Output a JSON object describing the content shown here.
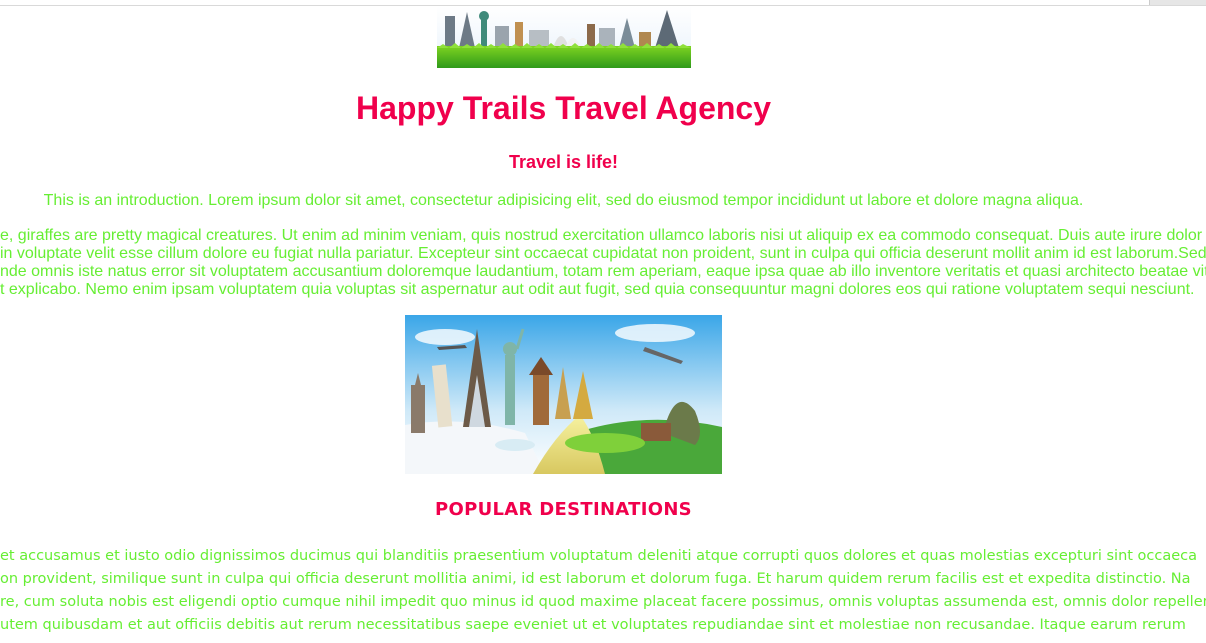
{
  "banner": {
    "icon": "world-landmarks-banner-image"
  },
  "header": {
    "title": "Happy Trails Travel Agency",
    "subtitle": "Travel is life!"
  },
  "intro": "This is an introduction. Lorem ipsum dolor sit amet, consectetur adipisicing elit, sed do eiusmod tempor incididunt ut labore et dolore magna aliqua.",
  "paragraph_lines": [
    "e, giraffes are pretty magical creatures. Ut enim ad minim veniam, quis nostrud exercitation ullamco laboris nisi ut aliquip ex ea commodo consequat. Duis aute irure dolor i",
    " in voluptate velit esse cillum dolore eu fugiat nulla pariatur. Excepteur sint occaecat cupidatat non proident, sunt in culpa qui officia deserunt mollit anim id est laborum.Sed",
    "nde omnis iste natus error sit voluptatem accusantium doloremque laudantium, totam rem aperiam, eaque ipsa quae ab illo inventore veritatis et quasi architecto beatae vit",
    "t explicabo. Nemo enim ipsam voluptatem quia voluptas sit aspernatur aut odit aut fugit, sed quia consequuntur magni dolores eos qui ratione voluptatem sequi nesciunt."
  ],
  "hero": {
    "icon": "world-travel-landmarks-image"
  },
  "destinations": {
    "heading": "POPULAR DESTINATIONS",
    "lines": [
      "et accusamus et iusto odio dignissimos ducimus qui blanditiis praesentium voluptatum deleniti atque corrupti quos dolores et quas molestias excepturi sint occaeca",
      "on provident, similique sunt in culpa qui officia deserunt mollitia animi, id est laborum et dolorum fuga. Et harum quidem rerum facilis est et expedita distinctio. Na",
      "re, cum soluta nobis est eligendi optio cumque nihil impedit quo minus id quod maxime placeat facere possimus, omnis voluptas assumenda est, omnis dolor repellend",
      "utem quibusdam et aut officiis debitis aut rerum necessitatibus saepe eveniet ut et voluptates repudiandae sint et molestiae non recusandae. Itaque earum rerum"
    ]
  },
  "colors": {
    "heading": "#f0004c",
    "body_text": "#66ee33",
    "background": "#ffffff"
  }
}
